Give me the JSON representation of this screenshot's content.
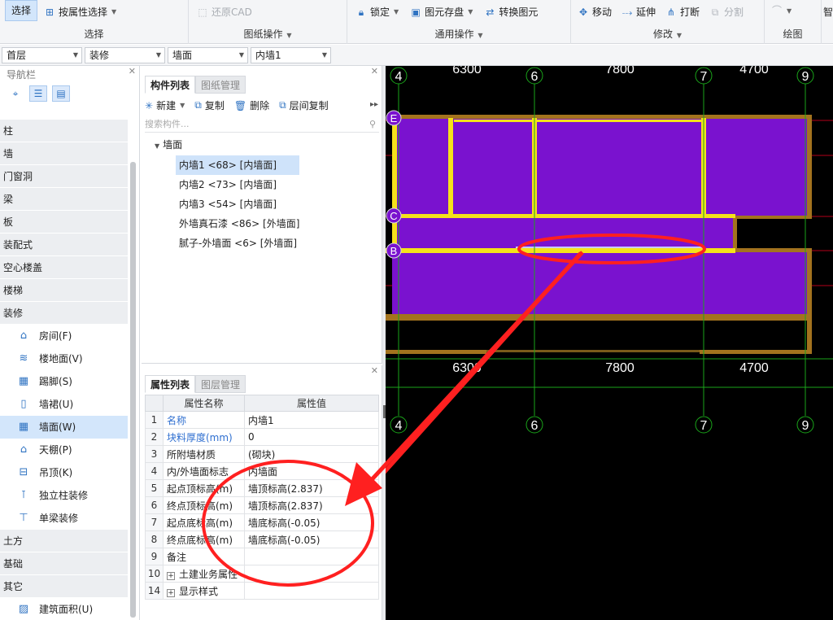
{
  "ribbon": {
    "select_label": "选择",
    "select_by_prop": "按属性选择",
    "select_group": "选择",
    "restore_cad": "还原CAD",
    "drawing_group": "图纸操作",
    "lock": "锁定",
    "store": "图元存盘",
    "convert": "转换图元",
    "general_group": "通用操作",
    "move": "移动",
    "extend": "延伸",
    "break": "打断",
    "split": "分割",
    "modify_group": "修改",
    "draw_group": "绘图",
    "cut_label": "智"
  },
  "dropdowns": {
    "floor": "首层",
    "category": "装修",
    "type": "墙面",
    "component": "内墙1"
  },
  "nav": {
    "title": "导航栏",
    "items": [
      {
        "label": "柱",
        "kind": "cat"
      },
      {
        "label": "墙",
        "kind": "cat"
      },
      {
        "label": "门窗洞",
        "kind": "cat"
      },
      {
        "label": "梁",
        "kind": "cat"
      },
      {
        "label": "板",
        "kind": "cat"
      },
      {
        "label": "装配式",
        "kind": "cat"
      },
      {
        "label": "空心楼盖",
        "kind": "cat"
      },
      {
        "label": "楼梯",
        "kind": "cat"
      },
      {
        "label": "装修",
        "kind": "cat"
      },
      {
        "label": "房间(F)",
        "kind": "sub",
        "icon": "house-icon"
      },
      {
        "label": "楼地面(V)",
        "kind": "sub",
        "icon": "floor-icon"
      },
      {
        "label": "踢脚(S)",
        "kind": "sub",
        "icon": "skirting-icon"
      },
      {
        "label": "墙裙(U)",
        "kind": "sub",
        "icon": "dado-icon"
      },
      {
        "label": "墙面(W)",
        "kind": "sub",
        "icon": "wall-face-icon",
        "selected": true
      },
      {
        "label": "天棚(P)",
        "kind": "sub",
        "icon": "ceiling-icon"
      },
      {
        "label": "吊顶(K)",
        "kind": "sub",
        "icon": "suspended-ceiling-icon"
      },
      {
        "label": "独立柱装修",
        "kind": "sub",
        "icon": "column-finish-icon"
      },
      {
        "label": "单梁装修",
        "kind": "sub",
        "icon": "beam-finish-icon"
      },
      {
        "label": "土方",
        "kind": "cat"
      },
      {
        "label": "基础",
        "kind": "cat"
      },
      {
        "label": "其它",
        "kind": "cat"
      },
      {
        "label": "建筑面积(U)",
        "kind": "sub",
        "icon": "area-icon"
      }
    ]
  },
  "component_panel": {
    "tab_active": "构件列表",
    "tab_other": "图纸管理",
    "new": "新建",
    "copy": "复制",
    "delete": "删除",
    "floor_copy": "层间复制",
    "search_placeholder": "搜索构件...",
    "root": "墙面",
    "items": [
      "内墙1 <68> [内墙面]",
      "内墙2 <73> [内墙面]",
      "内墙3 <54> [内墙面]",
      "外墙真石漆 <86> [外墙面]",
      "腻子-外墙面 <6> [外墙面]"
    ]
  },
  "property_panel": {
    "tab_active": "属性列表",
    "tab_other": "图层管理",
    "col_name": "属性名称",
    "col_value": "属性值",
    "rows": [
      {
        "n": "1",
        "k": "名称",
        "v": "内墙1",
        "blue": true
      },
      {
        "n": "2",
        "k": "块料厚度(mm)",
        "v": "0",
        "blue": true
      },
      {
        "n": "3",
        "k": "所附墙材质",
        "v": "(砌块)"
      },
      {
        "n": "4",
        "k": "内/外墙面标志",
        "v": "内墙面"
      },
      {
        "n": "5",
        "k": "起点顶标高(m)",
        "v": "墙顶标高(2.837)"
      },
      {
        "n": "6",
        "k": "终点顶标高(m)",
        "v": "墙顶标高(2.837)"
      },
      {
        "n": "7",
        "k": "起点底标高(m)",
        "v": "墙底标高(-0.05)"
      },
      {
        "n": "8",
        "k": "终点底标高(m)",
        "v": "墙底标高(-0.05)"
      },
      {
        "n": "9",
        "k": "备注",
        "v": ""
      },
      {
        "n": "10",
        "k": "土建业务属性",
        "v": "",
        "expand": true
      },
      {
        "n": "14",
        "k": "显示样式",
        "v": "",
        "expand": true
      }
    ]
  },
  "canvas": {
    "dims_top": [
      "6300",
      "7800",
      "4700"
    ],
    "dims_bottom": [
      "6300",
      "7800",
      "4700"
    ],
    "axes": [
      "4",
      "6",
      "7",
      "9"
    ],
    "row_axes": [
      "E",
      "C",
      "B"
    ],
    "colors": {
      "fill": "#7a12cf",
      "wall": "#f5e21a",
      "edge": "#a3731e",
      "grid": "#1aa51a",
      "red": "#ff2020"
    }
  }
}
